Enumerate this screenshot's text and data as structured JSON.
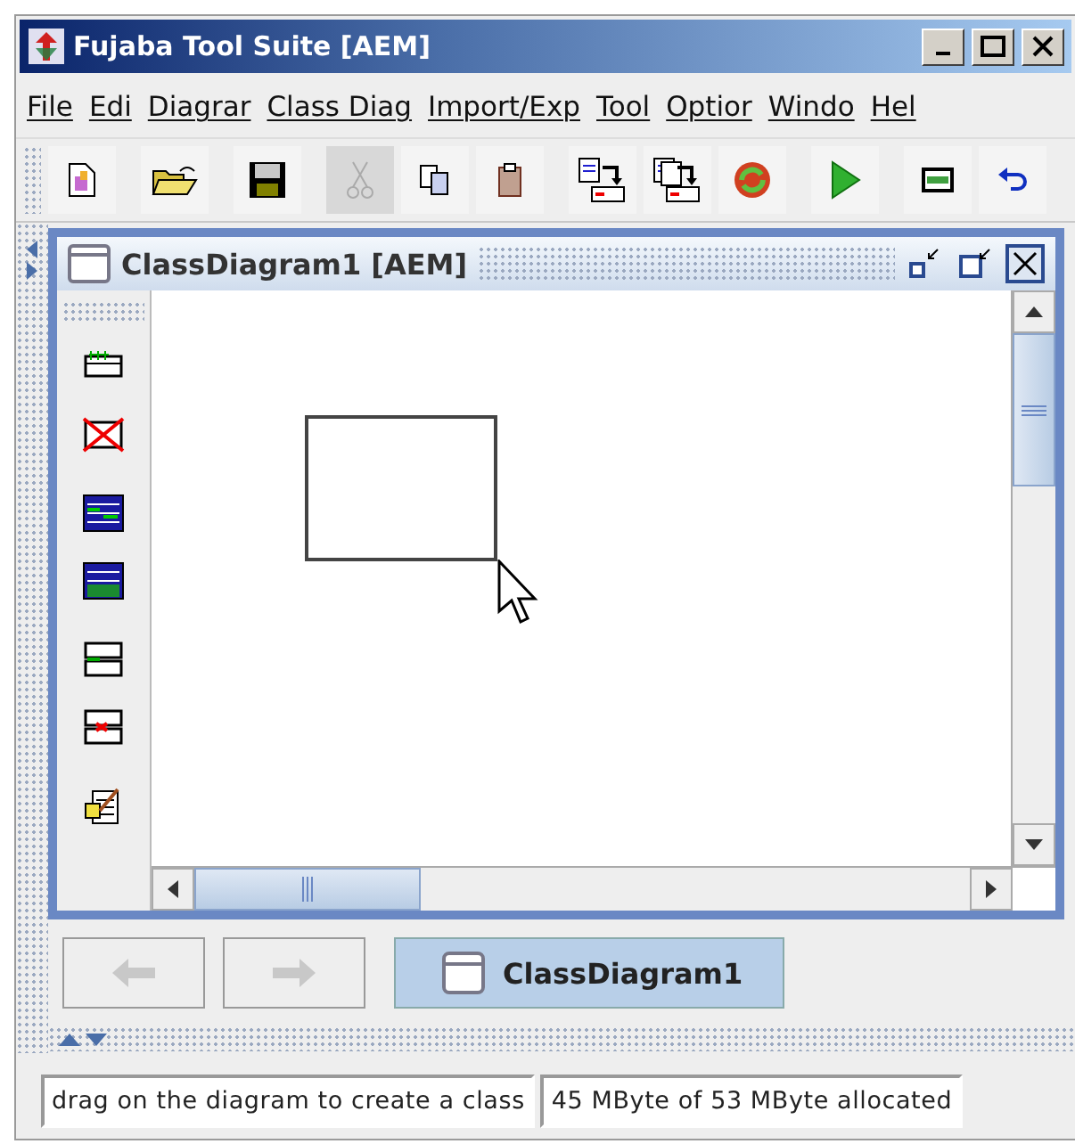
{
  "window": {
    "title": "Fujaba Tool Suite [AEM]"
  },
  "menu": [
    "File",
    "Edi",
    "Diagrar",
    "Class Diag",
    "Import/Exp",
    "Tool",
    "Optior",
    "Windo",
    "Hel"
  ],
  "toolbar": [
    {
      "kind": "new",
      "disabled": false
    },
    {
      "kind": "open",
      "disabled": false
    },
    {
      "kind": "save",
      "disabled": false
    },
    {
      "kind": "cut",
      "disabled": true
    },
    {
      "kind": "copy",
      "disabled": false
    },
    {
      "kind": "paste",
      "disabled": false
    },
    {
      "kind": "export",
      "disabled": false
    },
    {
      "kind": "export2",
      "disabled": false
    },
    {
      "kind": "refresh",
      "disabled": false
    },
    {
      "kind": "run",
      "disabled": false
    },
    {
      "kind": "panel",
      "disabled": false
    },
    {
      "kind": "undo",
      "disabled": false
    }
  ],
  "inner_window": {
    "title": "ClassDiagram1 [AEM]"
  },
  "nav": [
    {
      "kind": "back",
      "disabled": true
    },
    {
      "kind": "forward",
      "disabled": true
    }
  ],
  "tabs": [
    {
      "label": "ClassDiagram1",
      "selected": true
    }
  ],
  "status_bar": [
    "drag on the diagram to create a class",
    "45 MByte of 53 MByte allocated"
  ]
}
